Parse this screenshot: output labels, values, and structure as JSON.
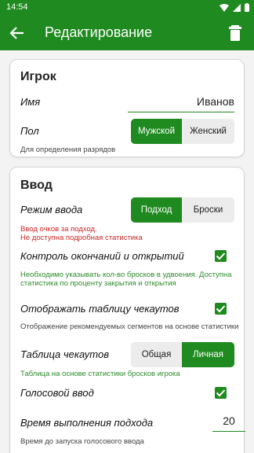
{
  "status": {
    "time": "14:54"
  },
  "appbar": {
    "title": "Редактирование"
  },
  "player": {
    "header": "Игрок",
    "name_label": "Имя",
    "name_value": "Иванов",
    "gender_label": "Пол",
    "gender_options": [
      "Мужской",
      "Женский"
    ],
    "gender_selected": "Мужской",
    "gender_hint": "Для определения разрядов"
  },
  "input": {
    "header": "Ввод",
    "mode_label": "Режим ввода",
    "mode_options": [
      "Подход",
      "Броски"
    ],
    "mode_selected": "Подход",
    "mode_warning": "Ввод очков за подход.\nНе доступна подробная статистика",
    "control_label": "Контроль окончаний и открытий",
    "control_checked": true,
    "control_hint": "Необходимо указывать кол-во бросков в удвоения. Доступна статистика по проценту закрытия и открытия",
    "checkout_show_label": "Отображать таблицу чекаутов",
    "checkout_show_checked": true,
    "checkout_show_hint": "Отображение рекомендуемых сегментов на основе статистики",
    "checkout_table_label": "Таблица чекаутов",
    "checkout_table_options": [
      "Общая",
      "Личная"
    ],
    "checkout_table_selected": "Личная",
    "checkout_table_hint": "Таблица на основе статистики бросков игрока",
    "voice_label": "Голосовой ввод",
    "voice_checked": true,
    "time_label": "Время выполнения подхода",
    "time_value": "20",
    "time_hint": "Время до запуска голосового ввода"
  },
  "colors": {
    "primary": "#1f8a1f",
    "warning": "#c62828"
  }
}
